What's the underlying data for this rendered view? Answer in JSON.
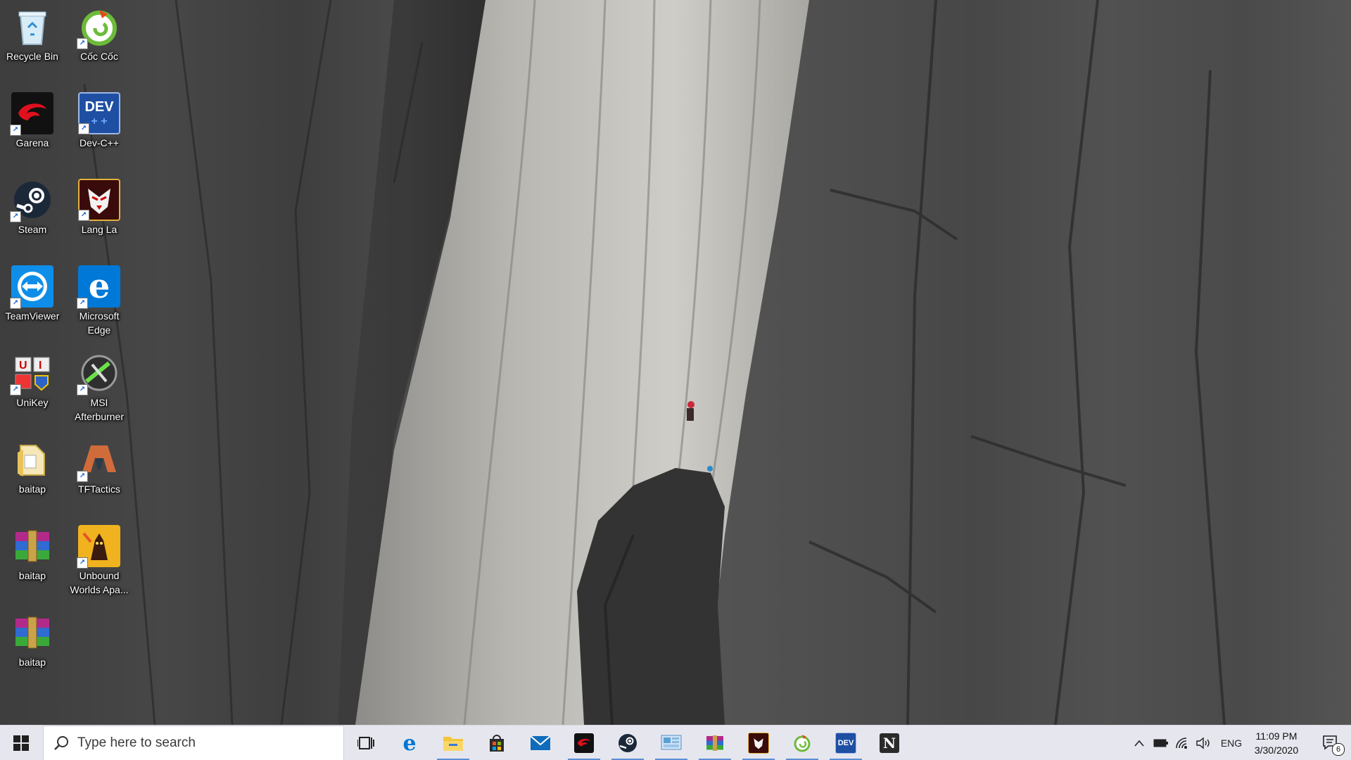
{
  "desktop": {
    "icons": [
      {
        "label": "Recycle Bin",
        "icon": "recycle-bin-icon",
        "color": "#cfe6f7"
      },
      {
        "label": "Cốc Cốc",
        "icon": "coccoc-icon",
        "color": "#7fbf3f"
      },
      {
        "label": "Garena",
        "icon": "garena-icon",
        "color": "#d0021b"
      },
      {
        "label": "Dev-C++",
        "icon": "devcpp-icon",
        "color": "#1e4fa3"
      },
      {
        "label": "Steam",
        "icon": "steam-icon",
        "color": "#1b2838"
      },
      {
        "label": "Lang La",
        "icon": "langla-icon",
        "color": "#a11b1b"
      },
      {
        "label": "TeamViewer",
        "icon": "teamviewer-icon",
        "color": "#0e8ee9"
      },
      {
        "label": "Microsoft Edge",
        "icon": "edge-icon",
        "color": "#0078d7"
      },
      {
        "label": "UniKey",
        "icon": "unikey-icon",
        "color": "#e8e8e8"
      },
      {
        "label": "MSI Afterburner",
        "icon": "msi-afterburner-icon",
        "color": "#3a3a3a"
      },
      {
        "label": "baitap",
        "icon": "folder-icon",
        "color": "#f3d26b"
      },
      {
        "label": "TFTactics",
        "icon": "tftactics-icon",
        "color": "#c7663a"
      },
      {
        "label": "baitap",
        "icon": "winrar-archive-icon",
        "color": "#7a3d8c"
      },
      {
        "label": "Unbound Worlds Apa...",
        "icon": "unbound-worlds-icon",
        "color": "#e8a317"
      },
      {
        "label": "baitap",
        "icon": "winrar-archive-icon",
        "color": "#7a3d8c"
      }
    ]
  },
  "taskbar": {
    "search_placeholder": "Type here to search",
    "pinned": [
      {
        "name": "task-view",
        "icon": "task-view-icon",
        "running": false
      },
      {
        "name": "edge",
        "icon": "edge-icon",
        "running": false,
        "color": "#0078d7"
      },
      {
        "name": "file-explorer",
        "icon": "folder-icon",
        "running": true,
        "color": "#f3c13a"
      },
      {
        "name": "microsoft-store",
        "icon": "store-icon",
        "running": false,
        "color": "#2b2b2b"
      },
      {
        "name": "mail",
        "icon": "mail-icon",
        "running": false,
        "color": "#0078d7"
      },
      {
        "name": "garena",
        "icon": "garena-icon",
        "running": true,
        "color": "#d0021b"
      },
      {
        "name": "steam",
        "icon": "steam-icon",
        "running": true,
        "color": "#1b2838"
      },
      {
        "name": "control-panel",
        "icon": "control-panel-icon",
        "running": true,
        "color": "#5aa0d8"
      },
      {
        "name": "winrar",
        "icon": "winrar-icon",
        "running": true,
        "color": "#7a3d8c"
      },
      {
        "name": "lang-la",
        "icon": "langla-icon",
        "running": true,
        "color": "#a11b1b"
      },
      {
        "name": "coccoc",
        "icon": "coccoc-icon",
        "running": true,
        "color": "#7fbf3f"
      },
      {
        "name": "devcpp",
        "icon": "devcpp-icon",
        "running": true,
        "color": "#1e4fa3"
      },
      {
        "name": "notion",
        "icon": "notion-icon",
        "running": false,
        "color": "#2b2b2b"
      }
    ],
    "tray": {
      "language": "ENG",
      "time": "11:09 PM",
      "date": "3/30/2020",
      "notifications": "6"
    }
  }
}
